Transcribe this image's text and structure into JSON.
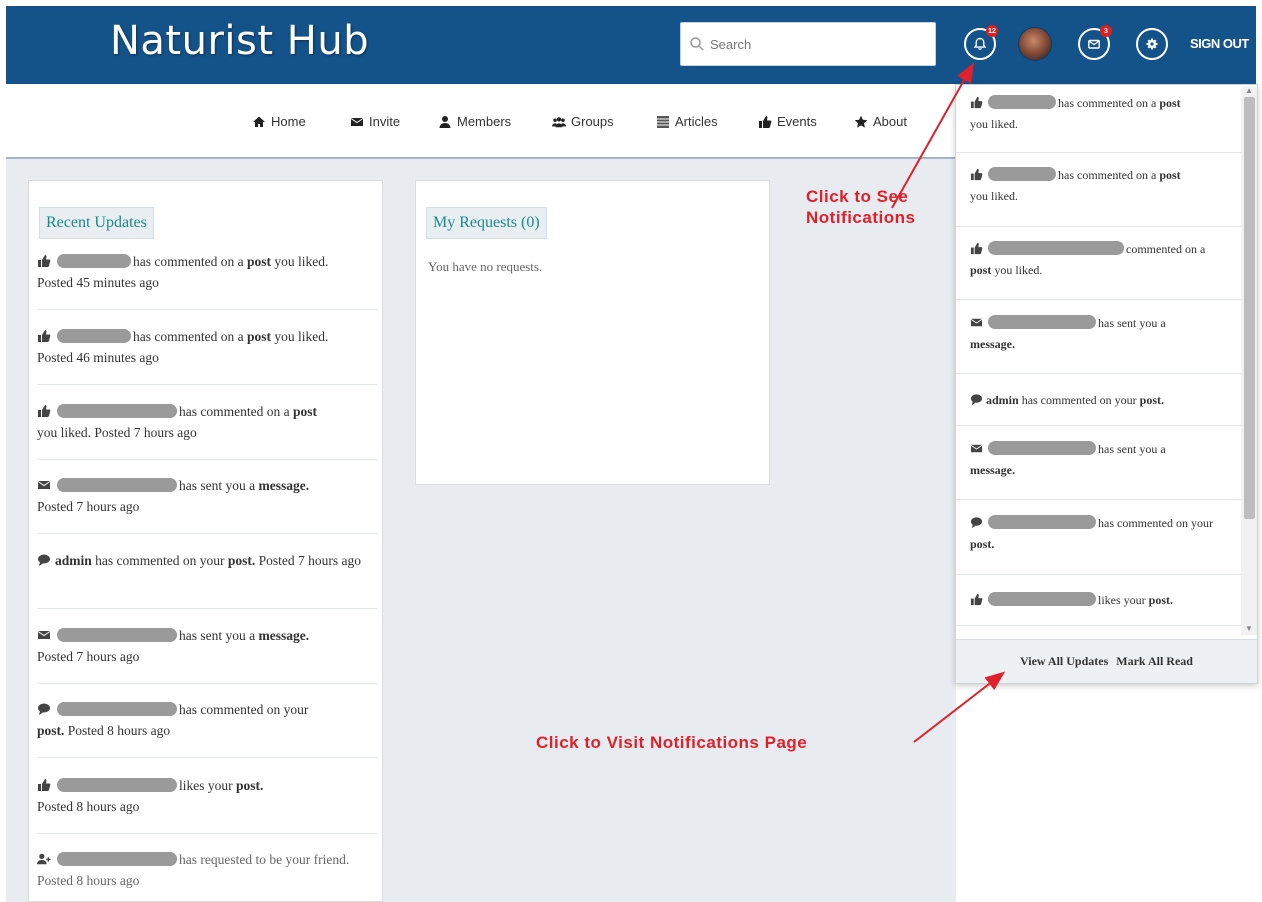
{
  "header": {
    "brand": "Naturist Hub",
    "search_placeholder": "Search",
    "notification_count": "12",
    "message_count": "3",
    "signout_label": "SIGN OUT"
  },
  "nav": {
    "items": [
      {
        "label": "Home",
        "icon": "home-icon"
      },
      {
        "label": "Invite",
        "icon": "envelope-icon"
      },
      {
        "label": "Members",
        "icon": "user-icon"
      },
      {
        "label": "Groups",
        "icon": "users-icon"
      },
      {
        "label": "Articles",
        "icon": "list-icon"
      },
      {
        "label": "Events",
        "icon": "thumbs-up-icon"
      },
      {
        "label": "About",
        "icon": "star-icon"
      }
    ]
  },
  "recent_updates": {
    "title": "Recent Updates",
    "items": [
      {
        "icon": "thumbs-up-icon",
        "text": "has commented on a",
        "bold": "post",
        "rest": "you liked.",
        "time": "Posted 45 minutes ago"
      },
      {
        "icon": "thumbs-up-icon",
        "text": "has commented on a",
        "bold": "post",
        "rest": "you liked.",
        "time": "Posted 46 minutes ago"
      },
      {
        "icon": "thumbs-up-icon",
        "text": "has commented on a",
        "bold": "post",
        "rest": "you liked.",
        "time": "Posted 7 hours ago"
      },
      {
        "icon": "envelope-icon",
        "text": "has sent you a",
        "bold": "message.",
        "rest": "",
        "time": "Posted 7 hours ago"
      },
      {
        "icon": "comment-icon",
        "text": "has commented on your",
        "bold": "post.",
        "rest": "",
        "time": "Posted 7 hours ago",
        "actor": "admin"
      },
      {
        "icon": "envelope-icon",
        "text": "has sent you a",
        "bold": "message.",
        "rest": "",
        "time": "Posted 7 hours ago"
      },
      {
        "icon": "comment-icon",
        "text": "has commented on your",
        "bold": "post.",
        "rest": "",
        "time": "Posted 8 hours ago"
      },
      {
        "icon": "thumbs-up-icon",
        "text": "likes your",
        "bold": "post.",
        "rest": "",
        "time": "Posted 8 hours ago"
      },
      {
        "icon": "user-plus-icon",
        "text": "has requested to be your friend.",
        "bold": "",
        "rest": "",
        "time": "Posted 8 hours ago"
      }
    ]
  },
  "requests": {
    "title": "My Requests (0)",
    "empty_text": "You have no requests."
  },
  "dropdown": {
    "items": [
      {
        "icon": "thumbs-up-icon",
        "text": "has commented on a",
        "bold": "post",
        "rest": "you liked."
      },
      {
        "icon": "thumbs-up-icon",
        "text": "has commented on a",
        "bold": "post",
        "rest": "you liked."
      },
      {
        "icon": "thumbs-up-icon",
        "text": "commented on a",
        "bold": "post",
        "rest": "you liked."
      },
      {
        "icon": "envelope-icon",
        "text": "has sent you a",
        "bold": "message.",
        "rest": ""
      },
      {
        "icon": "comment-icon",
        "actor": "admin",
        "text": "has commented on your",
        "bold": "post.",
        "rest": ""
      },
      {
        "icon": "envelope-icon",
        "text": "has sent you a",
        "bold": "message.",
        "rest": ""
      },
      {
        "icon": "comment-icon",
        "text": "has commented on your",
        "bold": "post.",
        "rest": ""
      },
      {
        "icon": "thumbs-up-icon",
        "text": "likes your",
        "bold": "post.",
        "rest": ""
      }
    ],
    "view_all": "View All Updates",
    "mark_all": "Mark All Read"
  },
  "annotations": {
    "see_notifications": "Click to See Notifications",
    "visit_page": "Click to Visit Notifications Page"
  },
  "colors": {
    "header_bg": "#14528a",
    "accent_teal": "#1b8a8a",
    "annotation_red": "#e0202a"
  }
}
